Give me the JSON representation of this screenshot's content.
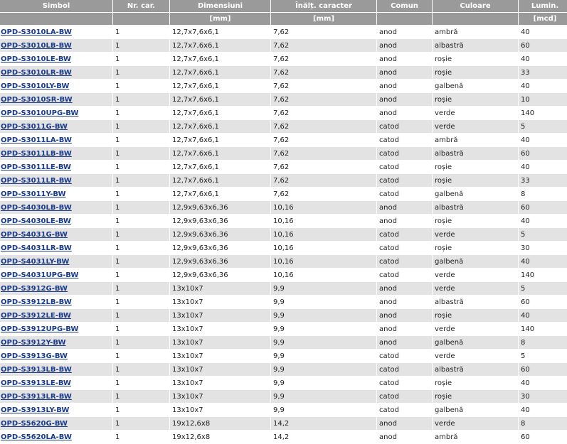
{
  "headers": [
    "Simbol",
    "Nr. car.",
    "Dimensiuni",
    "Înălț. caracter",
    "Comun",
    "Culoare",
    "Lumin."
  ],
  "units": [
    "",
    "",
    "[mm]",
    "[mm]",
    "",
    "",
    "[mcd]"
  ],
  "rows": [
    [
      "OPD-S3010LA-BW",
      "1",
      "12,7x7,6x6,1",
      "7,62",
      "anod",
      "ambră",
      "40"
    ],
    [
      "OPD-S3010LB-BW",
      "1",
      "12,7x7,6x6,1",
      "7,62",
      "anod",
      "albastră",
      "60"
    ],
    [
      "OPD-S3010LE-BW",
      "1",
      "12,7x7,6x6,1",
      "7,62",
      "anod",
      "roșie",
      "40"
    ],
    [
      "OPD-S3010LR-BW",
      "1",
      "12,7x7,6x6,1",
      "7,62",
      "anod",
      "roșie",
      "33"
    ],
    [
      "OPD-S3010LY-BW",
      "1",
      "12,7x7,6x6,1",
      "7,62",
      "anod",
      "galbenă",
      "40"
    ],
    [
      "OPD-S3010SR-BW",
      "1",
      "12,7x7,6x6,1",
      "7,62",
      "anod",
      "roșie",
      "10"
    ],
    [
      "OPD-S3010UPG-BW",
      "1",
      "12,7x7,6x6,1",
      "7,62",
      "anod",
      "verde",
      "140"
    ],
    [
      "OPD-S3011G-BW",
      "1",
      "12,7x7,6x6,1",
      "7,62",
      "catod",
      "verde",
      "5"
    ],
    [
      "OPD-S3011LA-BW",
      "1",
      "12,7x7,6x6,1",
      "7,62",
      "catod",
      "ambră",
      "40"
    ],
    [
      "OPD-S3011LB-BW",
      "1",
      "12,7x7,6x6,1",
      "7,62",
      "catod",
      "albastră",
      "60"
    ],
    [
      "OPD-S3011LE-BW",
      "1",
      "12,7x7,6x6,1",
      "7,62",
      "catod",
      "roșie",
      "40"
    ],
    [
      "OPD-S3011LR-BW",
      "1",
      "12,7x7,6x6,1",
      "7,62",
      "catod",
      "roșie",
      "33"
    ],
    [
      "OPD-S3011Y-BW",
      "1",
      "12,7x7,6x6,1",
      "7,62",
      "catod",
      "galbenă",
      "8"
    ],
    [
      "OPD-S4030LB-BW",
      "1",
      "12,9x9,63x6,36",
      "10,16",
      "anod",
      "albastră",
      "60"
    ],
    [
      "OPD-S4030LE-BW",
      "1",
      "12,9x9,63x6,36",
      "10,16",
      "anod",
      "roșie",
      "40"
    ],
    [
      "OPD-S4031G-BW",
      "1",
      "12,9x9,63x6,36",
      "10,16",
      "catod",
      "verde",
      "5"
    ],
    [
      "OPD-S4031LR-BW",
      "1",
      "12,9x9,63x6,36",
      "10,16",
      "catod",
      "roșie",
      "30"
    ],
    [
      "OPD-S4031LY-BW",
      "1",
      "12,9x9,63x6,36",
      "10,16",
      "catod",
      "galbenă",
      "40"
    ],
    [
      "OPD-S4031UPG-BW",
      "1",
      "12,9x9,63x6,36",
      "10,16",
      "catod",
      "verde",
      "140"
    ],
    [
      "OPD-S3912G-BW",
      "1",
      "13x10x7",
      "9,9",
      "anod",
      "verde",
      "5"
    ],
    [
      "OPD-S3912LB-BW",
      "1",
      "13x10x7",
      "9,9",
      "anod",
      "albastră",
      "60"
    ],
    [
      "OPD-S3912LE-BW",
      "1",
      "13x10x7",
      "9,9",
      "anod",
      "roșie",
      "40"
    ],
    [
      "OPD-S3912UPG-BW",
      "1",
      "13x10x7",
      "9,9",
      "anod",
      "verde",
      "140"
    ],
    [
      "OPD-S3912Y-BW",
      "1",
      "13x10x7",
      "9,9",
      "anod",
      "galbenă",
      "8"
    ],
    [
      "OPD-S3913G-BW",
      "1",
      "13x10x7",
      "9,9",
      "catod",
      "verde",
      "5"
    ],
    [
      "OPD-S3913LB-BW",
      "1",
      "13x10x7",
      "9,9",
      "catod",
      "albastră",
      "60"
    ],
    [
      "OPD-S3913LE-BW",
      "1",
      "13x10x7",
      "9,9",
      "catod",
      "roșie",
      "40"
    ],
    [
      "OPD-S3913LR-BW",
      "1",
      "13x10x7",
      "9,9",
      "catod",
      "roșie",
      "30"
    ],
    [
      "OPD-S3913LY-BW",
      "1",
      "13x10x7",
      "9,9",
      "catod",
      "galbenă",
      "40"
    ],
    [
      "OPD-S5620G-BW",
      "1",
      "19x12,6x8",
      "14,2",
      "anod",
      "verde",
      "8"
    ],
    [
      "OPD-S5620LA-BW",
      "1",
      "19x12,6x8",
      "14,2",
      "anod",
      "ambră",
      "60"
    ]
  ]
}
